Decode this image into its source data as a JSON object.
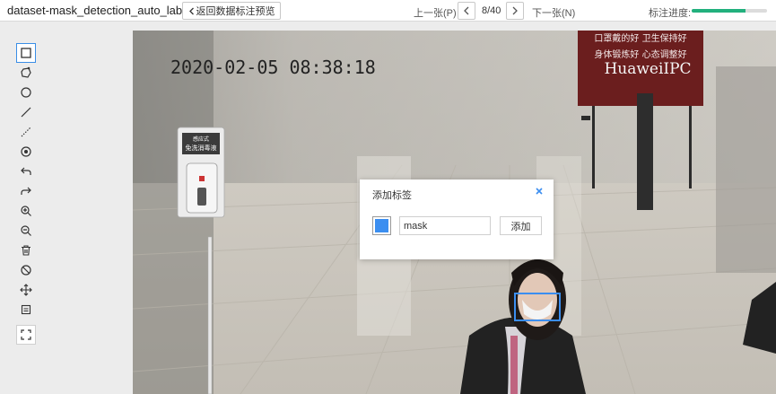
{
  "header": {
    "app_title": "dataset-mask_detection_auto_labeling",
    "back_label": "返回数据标注预览",
    "prev_label": "上一张(P)",
    "page_indicator": "8/40",
    "next_label": "下一张(N)",
    "progress_label": "标注进度:",
    "progress_fraction": 0.72,
    "progress_color": "#22b07d"
  },
  "toolbar": {
    "tools": [
      {
        "name": "rectangle-tool",
        "icon": "square-icon",
        "active": true
      },
      {
        "name": "polygon-tool",
        "icon": "polygon-icon"
      },
      {
        "name": "circle-tool",
        "icon": "circle-icon"
      },
      {
        "name": "line-tool",
        "icon": "line-icon"
      },
      {
        "name": "dashed-line-tool",
        "icon": "dashed-line-icon"
      },
      {
        "name": "point-tool",
        "icon": "point-icon"
      },
      {
        "name": "undo-tool",
        "icon": "undo-icon"
      },
      {
        "name": "redo-tool",
        "icon": "redo-icon"
      },
      {
        "name": "zoom-in-tool",
        "icon": "zoom-in-icon"
      },
      {
        "name": "zoom-out-tool",
        "icon": "zoom-out-icon"
      },
      {
        "name": "delete-tool",
        "icon": "trash-icon"
      },
      {
        "name": "hide-tool",
        "icon": "eye-off-icon"
      },
      {
        "name": "move-tool",
        "icon": "move-icon"
      },
      {
        "name": "label-list-tool",
        "icon": "list-icon"
      },
      {
        "name": "fit-screen-tool",
        "icon": "fit-screen-icon"
      }
    ]
  },
  "image": {
    "timestamp": "2020-02-05 08:38:18",
    "sign_text": "免洗消毒液",
    "sign_small_text": "感应式",
    "banner_line1": "口罩戴的好 卫生保持好",
    "banner_line2": "身体锻炼好 心态调整好",
    "banner_brand": "HuaweiIPC",
    "bbox_color": "#3b8ef0"
  },
  "dialog": {
    "title": "添加标签",
    "input_value": "mask",
    "add_label": "添加",
    "swatch_color": "#3b8ef0"
  }
}
